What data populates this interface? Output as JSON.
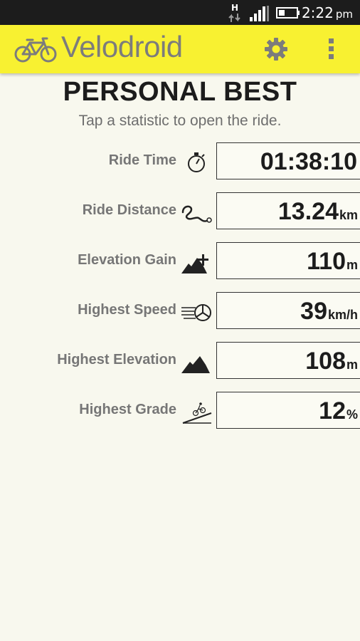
{
  "status_bar": {
    "network_type": "H",
    "time": "2:22",
    "ampm": "pm",
    "icons": [
      "network-activity-icon",
      "signal-strength-icon",
      "battery-icon"
    ]
  },
  "action_bar": {
    "title": "Velodroid",
    "logo_icon": "bicycle-icon",
    "actions": [
      "settings-gear-icon",
      "overflow-menu-icon"
    ],
    "background_color": "#f8f131"
  },
  "page": {
    "heading": "PERSONAL BEST",
    "subheading": "Tap a statistic to open the ride."
  },
  "stats": [
    {
      "label": "Ride Time",
      "value": "01:38:10",
      "unit": "",
      "icon": "stopwatch-icon"
    },
    {
      "label": "Ride Distance",
      "value": "13.24",
      "unit": "km",
      "icon": "winding-road-icon"
    },
    {
      "label": "Elevation Gain",
      "value": "110",
      "unit": "m",
      "icon": "mountain-plus-icon"
    },
    {
      "label": "Highest Speed",
      "value": "39",
      "unit": "km/h",
      "icon": "speeding-wheel-icon"
    },
    {
      "label": "Highest Elevation",
      "value": "108",
      "unit": "m",
      "icon": "mountain-icon"
    },
    {
      "label": "Highest Grade",
      "value": "12",
      "unit": "%",
      "icon": "cyclist-slope-icon"
    }
  ]
}
